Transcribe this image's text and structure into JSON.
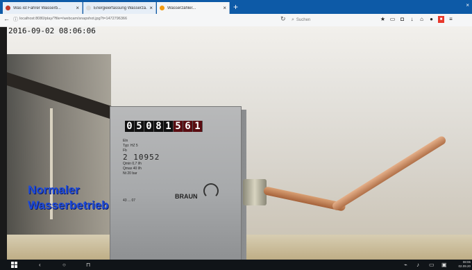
{
  "browser": {
    "tabs": [
      {
        "label": "Was ist Fahrer Wasserb...",
        "favicon_color": "#c0392b",
        "active": false
      },
      {
        "label": "Energieerfassung Wasserzä...",
        "favicon_color": "#d9d9d9",
        "active": false
      },
      {
        "label": "Wasserzähler...",
        "favicon_color": "#f39c12",
        "active": true
      }
    ],
    "close_glyph": "×",
    "new_tab_glyph": "+",
    "window_close_glyph": "×",
    "url": "localhost:8080/play/?file=/webcam/snapshot.jpg?t=1472796366",
    "search_placeholder": "Suchen",
    "toolbar_icons": [
      "star-icon",
      "reader-icon",
      "pocket-icon",
      "download-icon",
      "home-icon",
      "sync-icon",
      "addon-icon",
      "menu-icon"
    ]
  },
  "video": {
    "timestamp": "2016-09-02 08:06:06",
    "meter": {
      "digits": [
        "0",
        "5",
        "0",
        "8",
        "1",
        "5",
        "6",
        "1"
      ],
      "plate_lines": [
        "Eln",
        "Typ: HZ 5",
        "Fb"
      ],
      "serial": "2 10952",
      "spec_lines": [
        "Qmin 0,7 l/h",
        "Qmax 40 l/h",
        "Nt 20 bar"
      ],
      "bottom_code": "43 ... 07",
      "brand": "BRAUN"
    },
    "overlay_line1": "Normaler",
    "overlay_line2": "Wasserbetrieb"
  },
  "taskbar": {
    "back_glyph": "‹",
    "cortana_glyph": "○",
    "task_view_glyph": "⊓",
    "clock_time": "08:06",
    "clock_date": "02.09.20",
    "tray_icons": [
      "network-icon",
      "volume-icon",
      "battery-icon",
      "keyboard-icon"
    ]
  }
}
